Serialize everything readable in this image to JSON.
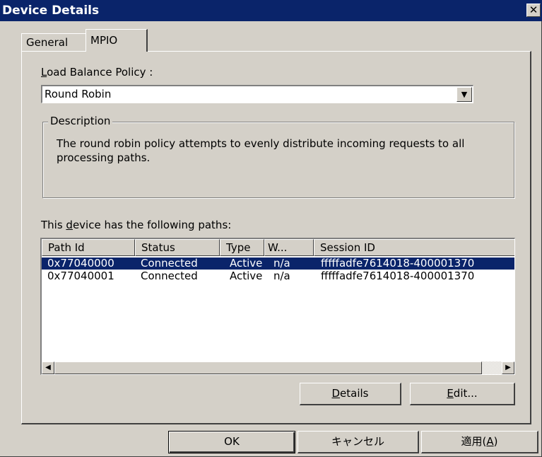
{
  "window": {
    "title": "Device Details",
    "close_glyph": "✕"
  },
  "tabs": [
    {
      "label": "General",
      "selected": false
    },
    {
      "label": "MPIO",
      "selected": true
    }
  ],
  "policy": {
    "label_accel": "L",
    "label_rest": "oad Balance Policy :",
    "value": "Round Robin"
  },
  "description": {
    "legend": "Description",
    "text": "The round robin policy attempts to evenly distribute incoming requests to all processing paths."
  },
  "paths": {
    "label_pre": "This ",
    "label_accel": "d",
    "label_post": "evice has the following paths:",
    "columns": [
      "Path Id",
      "Status",
      "Type",
      "W...",
      "Session ID"
    ],
    "rows": [
      {
        "path_id": "0x77040000",
        "status": "Connected",
        "type": "Active",
        "w": "n/a",
        "session_id": "fffffadfe7614018-400001370",
        "selected": true
      },
      {
        "path_id": "0x77040001",
        "status": "Connected",
        "type": "Active",
        "w": "n/a",
        "session_id": "fffffadfe7614018-400001370",
        "selected": false
      }
    ]
  },
  "buttons": {
    "details_accel": "D",
    "details_rest": "etails",
    "edit_accel": "E",
    "edit_rest": "dit...",
    "ok": "OK",
    "cancel": "キャンセル",
    "apply_pre": "適用(",
    "apply_accel": "A",
    "apply_post": ")"
  },
  "icons": {
    "dropdown": "▼",
    "scroll_left": "◀",
    "scroll_right": "▶"
  },
  "colors": {
    "titlebar": "#0a246a",
    "face": "#d4d0c8",
    "selection": "#0a246a"
  }
}
